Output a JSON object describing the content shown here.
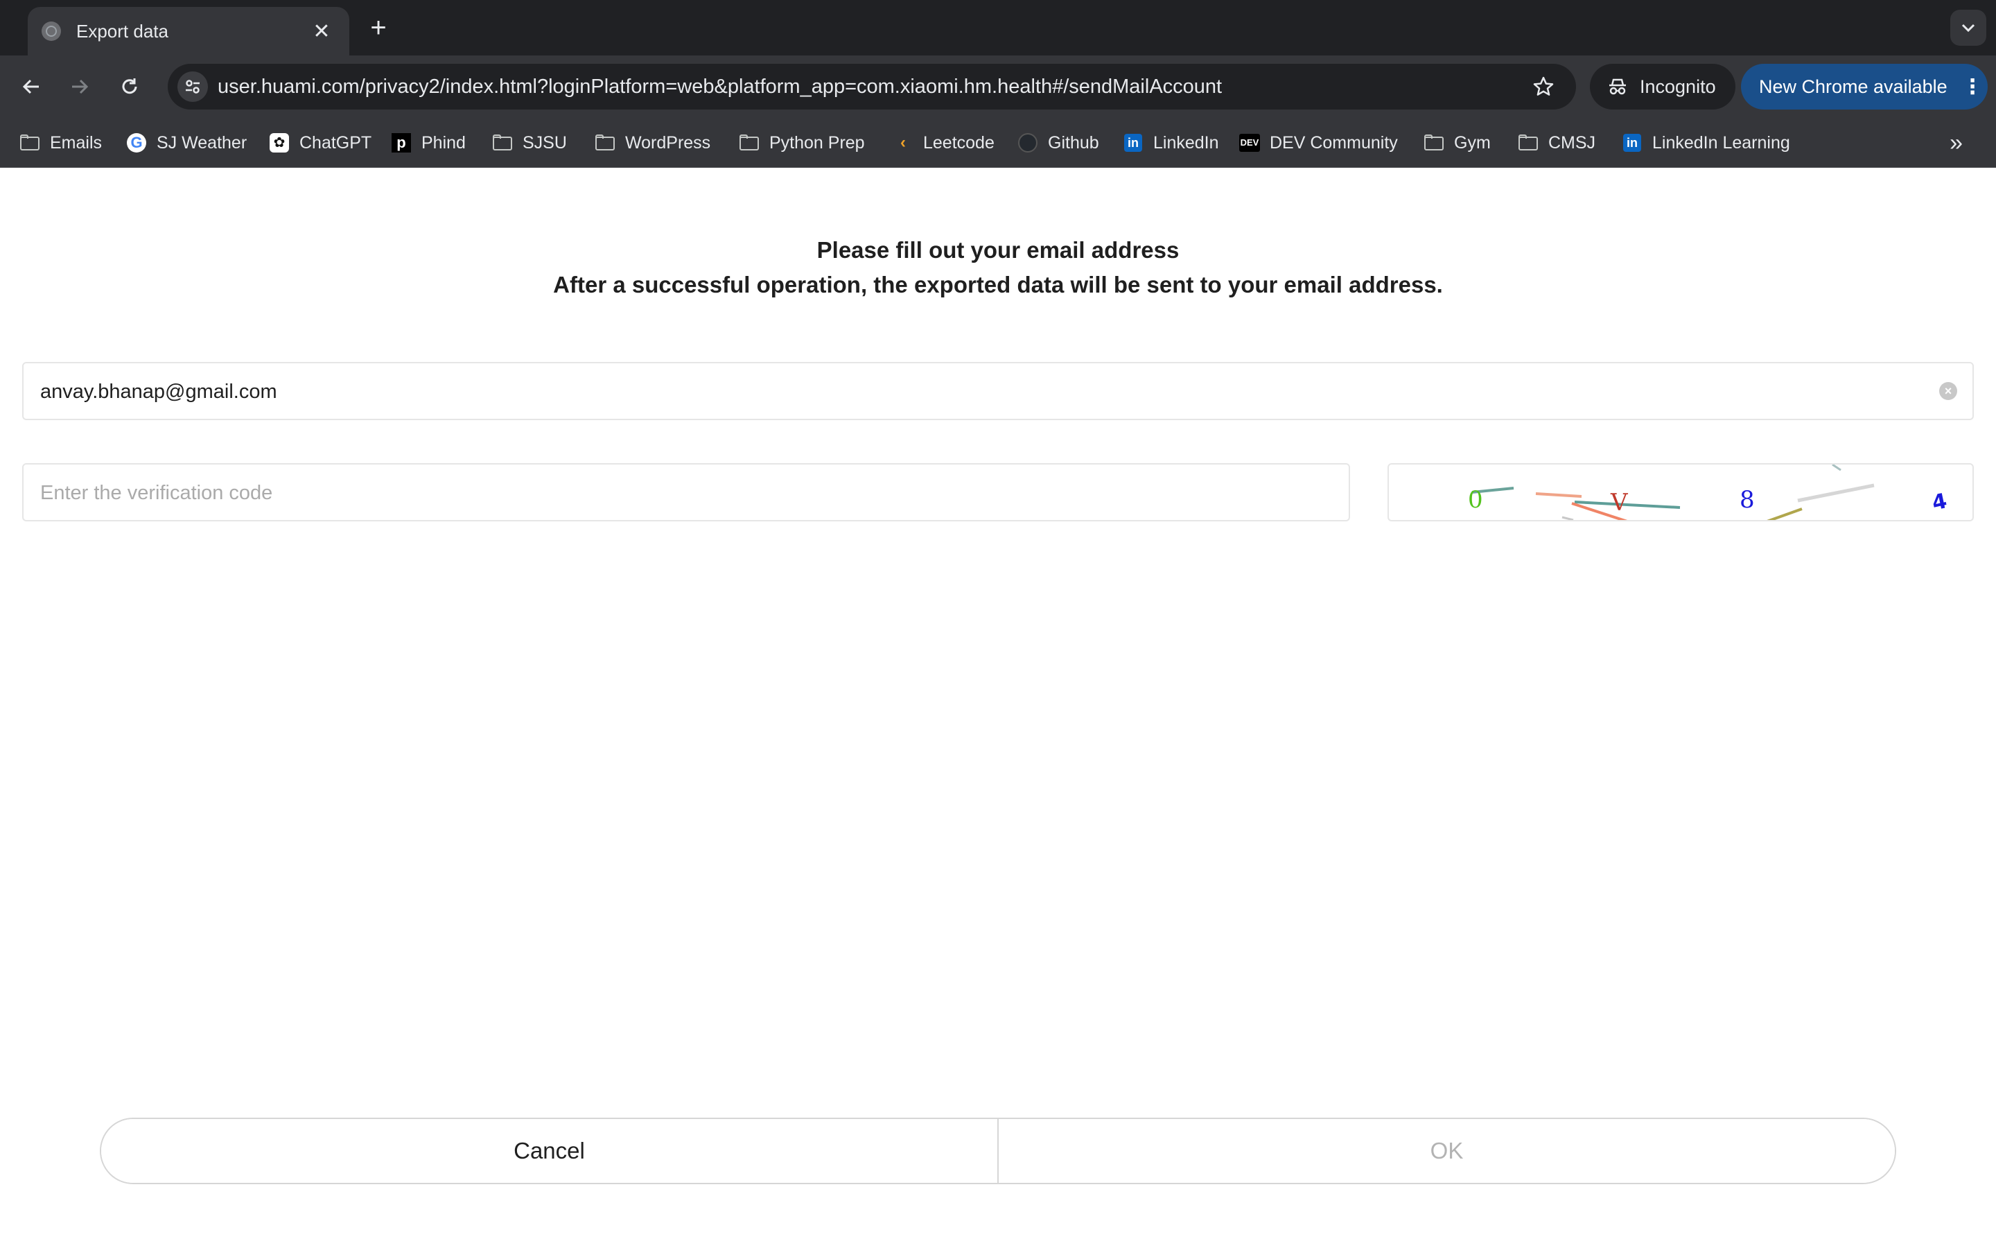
{
  "browser": {
    "tab": {
      "title": "Export data",
      "favicon": "globe-icon"
    },
    "url": "user.huami.com/privacy2/index.html?loginPlatform=web&platform_app=com.xiaomi.hm.health#/sendMailAccount",
    "incognito_label": "Incognito",
    "update_label": "New Chrome available",
    "bookmarks": [
      {
        "label": "Emails",
        "icon": "folder-icon"
      },
      {
        "label": "SJ Weather",
        "icon": "google-icon"
      },
      {
        "label": "ChatGPT",
        "icon": "chatgpt-icon"
      },
      {
        "label": "Phind",
        "icon": "phind-icon"
      },
      {
        "label": "SJSU",
        "icon": "folder-icon"
      },
      {
        "label": "WordPress",
        "icon": "folder-icon"
      },
      {
        "label": "Python Prep",
        "icon": "folder-icon"
      },
      {
        "label": "Leetcode",
        "icon": "leetcode-icon"
      },
      {
        "label": "Github",
        "icon": "github-icon"
      },
      {
        "label": "LinkedIn",
        "icon": "linkedin-icon"
      },
      {
        "label": "DEV Community",
        "icon": "dev-icon"
      },
      {
        "label": "Gym",
        "icon": "folder-icon"
      },
      {
        "label": "CMSJ",
        "icon": "folder-icon"
      },
      {
        "label": "LinkedIn Learning",
        "icon": "linkedin-icon"
      }
    ],
    "colors": {
      "tabbar": "#202124",
      "toolbar": "#35363a",
      "update_button": "#1a4f8a"
    }
  },
  "page": {
    "heading_line1": "Please fill out your email address",
    "heading_line2": "After a successful operation, the exported data will be sent to your email address.",
    "email": {
      "value": "anvay.bhanap@gmail.com"
    },
    "verification": {
      "placeholder": "Enter the verification code",
      "value": ""
    },
    "captcha": {
      "chars": [
        "0",
        "V",
        "8",
        "4"
      ],
      "colors": [
        "#53c21d",
        "#c0392b",
        "#1a1adb",
        "#1a1adb"
      ]
    },
    "buttons": {
      "cancel": "Cancel",
      "ok": "OK"
    }
  }
}
